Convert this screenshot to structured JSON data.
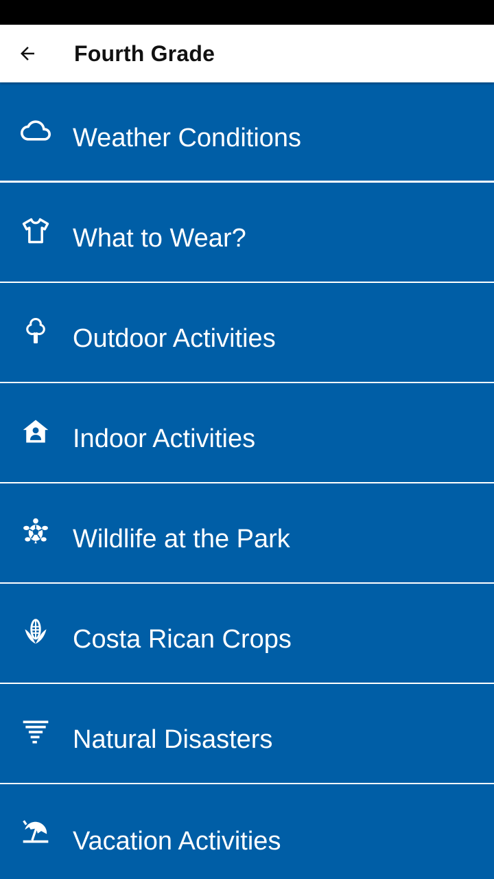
{
  "app_bar": {
    "title": "Fourth Grade",
    "back_icon": "arrow-back-icon"
  },
  "colors": {
    "item_background": "#005ea6",
    "divider": "#ffffff",
    "status_bar": "#000000"
  },
  "menu": {
    "items": [
      {
        "label": "Weather Conditions",
        "icon": "cloud-icon"
      },
      {
        "label": "What to Wear?",
        "icon": "tshirt-icon"
      },
      {
        "label": "Outdoor Activities",
        "icon": "tree-icon"
      },
      {
        "label": "Indoor Activities",
        "icon": "house-person-icon"
      },
      {
        "label": "Wildlife at the Park",
        "icon": "turtle-icon"
      },
      {
        "label": "Costa Rican Crops",
        "icon": "corn-icon"
      },
      {
        "label": "Natural Disasters",
        "icon": "tornado-icon"
      },
      {
        "label": "Vacation Activities",
        "icon": "beach-umbrella-icon"
      }
    ]
  }
}
